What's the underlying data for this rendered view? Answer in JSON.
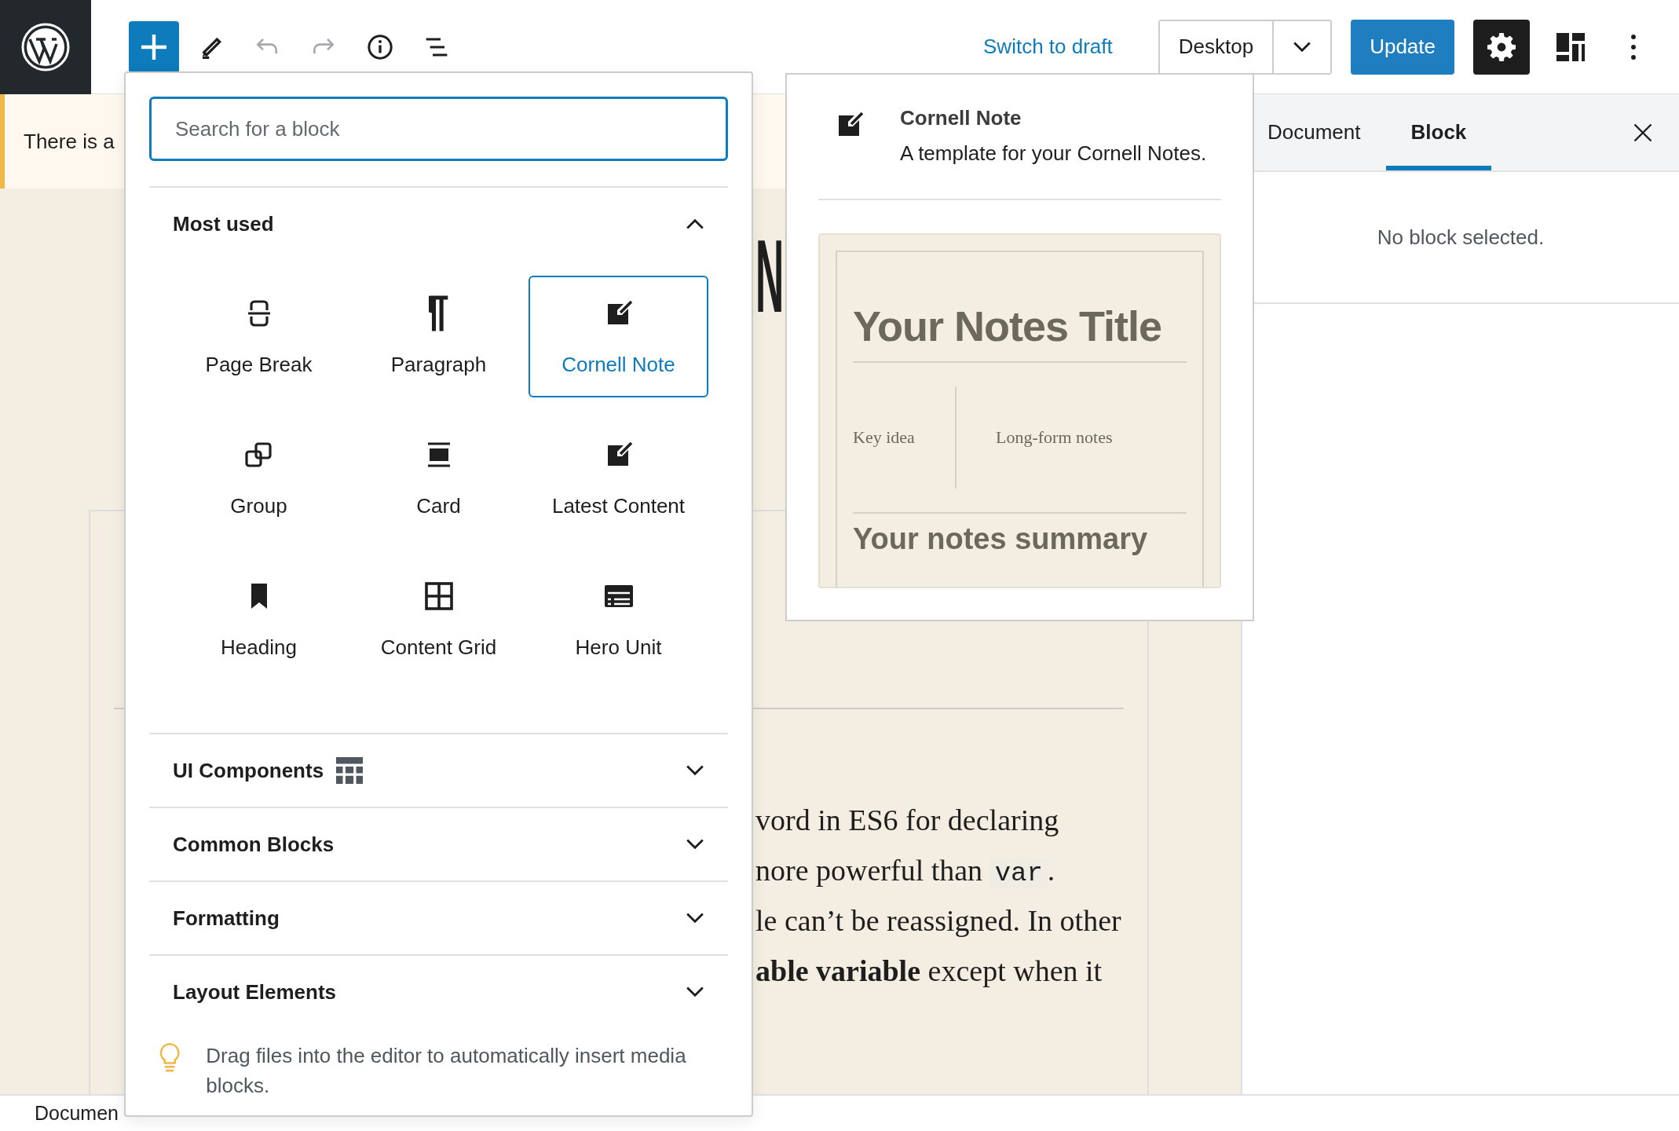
{
  "header": {
    "inserter_open": true,
    "undo_disabled": true,
    "redo_disabled": true,
    "switch_label": "Switch to draft",
    "device": "Desktop",
    "update_label": "Update",
    "settings_open": true
  },
  "notice": {
    "text": "There is a"
  },
  "editor": {
    "title_fragment": "N",
    "lines": [
      {
        "text": "vord in ES6 for declaring"
      },
      {
        "text": "nore powerful than ",
        "code": "var",
        "after": "."
      },
      {
        "text": "le can’t be reassigned. In other"
      },
      {
        "text": "**able variable** except when it"
      }
    ]
  },
  "inserter": {
    "search": {
      "placeholder": "Search for a block"
    },
    "sections": [
      {
        "title": "Most used",
        "expanded": true,
        "items": [
          {
            "label": "Page Break",
            "kind": "pagebreak",
            "selected": false
          },
          {
            "label": "Paragraph",
            "kind": "paragraph",
            "selected": false
          },
          {
            "label": "Cornell Note",
            "kind": "note",
            "selected": true
          },
          {
            "label": "Group",
            "kind": "group",
            "selected": false
          },
          {
            "label": "Card",
            "kind": "card",
            "selected": false
          },
          {
            "label": "Latest Content",
            "kind": "note",
            "selected": false
          },
          {
            "label": "Heading",
            "kind": "heading",
            "selected": false
          },
          {
            "label": "Content Grid",
            "kind": "grid",
            "selected": false
          },
          {
            "label": "Hero Unit",
            "kind": "hero",
            "selected": false
          }
        ]
      },
      {
        "title": "UI Components",
        "expanded": false,
        "has_icon": true
      },
      {
        "title": "Common Blocks",
        "expanded": false
      },
      {
        "title": "Formatting",
        "expanded": false
      },
      {
        "title": "Layout Elements",
        "expanded": false
      }
    ],
    "tip": "Drag files into the editor to automatically insert media blocks."
  },
  "preview": {
    "title": "Cornell Note",
    "description": "A template for your Cornell Notes.",
    "template": {
      "title": "Your Notes Title",
      "cue": "Key idea",
      "notes": "Long-form notes",
      "summary": "Your notes summary"
    }
  },
  "sidebar": {
    "tabs": [
      {
        "label": "Document",
        "selected": false
      },
      {
        "label": "Block",
        "selected": true
      }
    ],
    "empty_text": "No block selected."
  },
  "footer": {
    "text": "Documen"
  }
}
